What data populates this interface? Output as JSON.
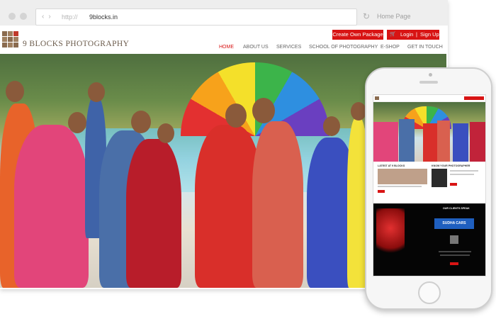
{
  "browser": {
    "url_prefix": "http://",
    "url": "9blocks.in",
    "home_label": "Home Page"
  },
  "site": {
    "brand": "9 BLOCKS PHOTOGRAPHY",
    "create_package": "Create Own Package",
    "login": "Login",
    "signup": "Sign Up",
    "login_separator": "|",
    "menu": [
      {
        "label": "HOME",
        "active": true
      },
      {
        "label": "ABOUT US"
      },
      {
        "label": "SERVICES"
      },
      {
        "label": "SCHOOL OF PHOTOGRAPHY"
      },
      {
        "label": "E-SHOP"
      },
      {
        "label": "GET IN TOUCH"
      }
    ]
  },
  "mobile": {
    "latest_heading": "LATEST AT 9 BLOCKS",
    "photographer_heading": "KNOW YOUR PHOTOGRAPHER",
    "clients_heading": "OUR CLIENTS SPEAK",
    "client_logo": "SUDHA CARS"
  },
  "colors": {
    "accent": "#d81414",
    "brand_text": "#6a5a4a"
  },
  "icons": {
    "cart": "shopping-cart-icon",
    "reload": "reload-icon"
  }
}
